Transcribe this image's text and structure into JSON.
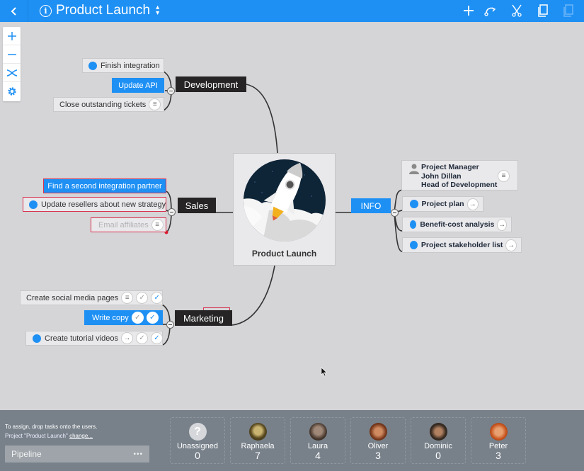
{
  "header": {
    "back_icon": "chevron-left-icon",
    "info_icon": "info-icon",
    "title": "Product Launch",
    "title_switch_icon": "up-down-arrows-icon",
    "actions": [
      {
        "name": "add",
        "icon": "plus-icon"
      },
      {
        "name": "connect",
        "icon": "relation-arrow-icon"
      },
      {
        "name": "cut",
        "icon": "scissors-icon"
      },
      {
        "name": "copy",
        "icon": "copy-icon"
      },
      {
        "name": "paste",
        "icon": "paste-icon",
        "disabled": true
      }
    ]
  },
  "toolbar": [
    {
      "name": "zoom-in",
      "icon": "plus-icon"
    },
    {
      "name": "zoom-out",
      "icon": "minus-icon"
    },
    {
      "name": "reorganize",
      "icon": "shuffle-icon"
    },
    {
      "name": "settings",
      "icon": "gear-icon"
    }
  ],
  "map": {
    "central": {
      "label": "Product Launch",
      "image": "rocket-illustration"
    },
    "topics": [
      {
        "label": "Development",
        "tasks": [
          {
            "label": "Finish integration",
            "dot": true
          },
          {
            "label": "Update API",
            "selected": true
          },
          {
            "label": "Close outstanding tickets",
            "badges": [
              "notes-icon"
            ]
          }
        ]
      },
      {
        "label": "Sales",
        "tasks": [
          {
            "label": "Find a second integration partner",
            "selected": true,
            "highlighted": true
          },
          {
            "label": "Update resellers about new strategy",
            "dot": true,
            "highlighted": true
          },
          {
            "label": "Email affiliates",
            "faded": true,
            "highlighted": true,
            "badges": [
              "notes-icon"
            ]
          }
        ]
      },
      {
        "label": "Marketing",
        "tasks": [
          {
            "label": "Create social media pages",
            "badges": [
              "notes-icon",
              "check-icon",
              "check-done-icon"
            ]
          },
          {
            "label": "Write copy",
            "selected": true,
            "badges": [
              "check-icon",
              "check-done-icon"
            ]
          },
          {
            "label": "Create tutorial videos",
            "dot": true,
            "badges": [
              "arrow-right-icon",
              "check-icon",
              "check-done-icon"
            ]
          }
        ]
      }
    ],
    "info": {
      "label": "INFO",
      "contact": {
        "line1": "Project Manager",
        "line2": "John Dillan",
        "line3": "Head of Development"
      },
      "links": [
        {
          "label": "Project plan"
        },
        {
          "label": "Benefit-cost analysis"
        },
        {
          "label": "Project stakeholder list"
        }
      ]
    }
  },
  "assign_panel": {
    "hint": "To assign, drop tasks onto the users.",
    "project_prefix": "Project \"Product Launch\"",
    "change_link": "change...",
    "pipeline_label": "Pipeline",
    "pipeline_menu": "•••",
    "users": [
      {
        "name": "Unassigned",
        "count": "0",
        "avatar": "question-icon"
      },
      {
        "name": "Raphaela",
        "count": "7",
        "color": "#7a6a2a"
      },
      {
        "name": "Laura",
        "count": "4",
        "color": "#4a3a30"
      },
      {
        "name": "Oliver",
        "count": "3",
        "color": "#8a3a20"
      },
      {
        "name": "Dominic",
        "count": "0",
        "color": "#3a2c22"
      },
      {
        "name": "Peter",
        "count": "3",
        "color": "#c8541e"
      }
    ]
  }
}
